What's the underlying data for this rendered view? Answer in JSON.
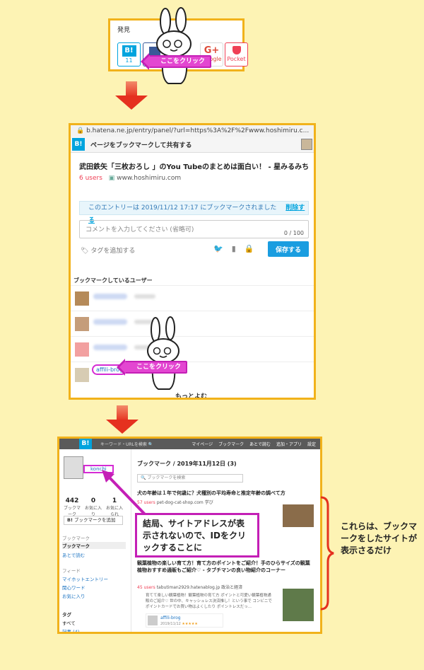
{
  "step1": {
    "section_label": "発見",
    "hatena_logo": "B!",
    "hatena_count": "11",
    "google_label": "Google",
    "pocket_label": "Pocket",
    "click_label": "ここをクリック"
  },
  "step2": {
    "url": "b.hatena.ne.jp/entry/panel/?url=https%3A%2F%2Fwww.hoshimiru.c...",
    "logo": "B!",
    "header_title": "ページをブックマークして共有する",
    "entry_title": "武田鉄矢「三枚おろし 」のYou Tubeのまとめは面白い！ - 星みるみち",
    "users": "6 users",
    "domain": "www.hoshimiru.com",
    "notice": "このエントリーは 2019/11/12 17:17 にブックマークされました",
    "delete_link": "削除する",
    "comment_placeholder": "コメントを入力してください (省略可)",
    "comment_count": "0 / 100",
    "tag_add": "タグを追加する",
    "save_button": "保存する",
    "users_header": "ブックマークしているユーザー",
    "affili_user": "affili-brog",
    "click_label": "ここをクリック",
    "more": "もっとよむ"
  },
  "step3": {
    "logo": "B!",
    "search_placeholder": "キーワード・URLを検索",
    "nav": [
      "マイページ",
      "ブックマーク",
      "あとで読む",
      "追加・アプリ",
      "設定"
    ],
    "user_id": "konchi",
    "stats": [
      {
        "value": "442",
        "label": "ブックマーク"
      },
      {
        "value": "0",
        "label": "お気に入り"
      },
      {
        "value": "1",
        "label": "お気に入られ"
      }
    ],
    "add_bm": "ブックマークを追加",
    "side_sections": [
      {
        "head": "ブックマーク",
        "items": [
          "ブックマーク",
          "あとで読む"
        ]
      },
      {
        "head": "フィード",
        "items": [
          "マイホットエントリー",
          "関心ワード",
          "お気に入り"
        ]
      },
      {
        "head": "タグ",
        "items": [
          "すべて",
          "記事 (4)"
        ]
      }
    ],
    "main_title": "ブックマーク / 2019年11月12日 (3)",
    "main_search": "ブックマークを検索",
    "entries": [
      {
        "title": "犬の年齢は１年で何歳に？犬種別の平均寿命と推定年齢の調べて方",
        "users": "57 users",
        "domain": "pet-dog-cat-shop.com",
        "tag": "学び"
      },
      {
        "title": "観葉植物の楽しい育て方！育て方のポイントをご紹介！手のひらサイズの観葉植物おすすめ通販もご紹介♡ - タブチマンの良い物紹介のコーナー",
        "users": "45 users",
        "domain": "tabutiman2929.hatenablog.jp",
        "tag": "政治と経済",
        "snippet": "育てて楽しい観葉植物！観葉植物の育て方 ポイントと可愛い観葉植物通販のご紹介♡ 世の中、キャッシュレス決済推し！という事で コンビニでポイントカードでお買い物はよくしたり ポイントレスだっ...",
        "user": "affili-brog",
        "date": "2019/11/12",
        "stars": "★★★★★"
      }
    ]
  },
  "callout": "結局、サイトアドレスが表示されないので、IDをクリックすることに",
  "sidenote": "これらは、ブックマークをしたサイトが表示さるだけ"
}
